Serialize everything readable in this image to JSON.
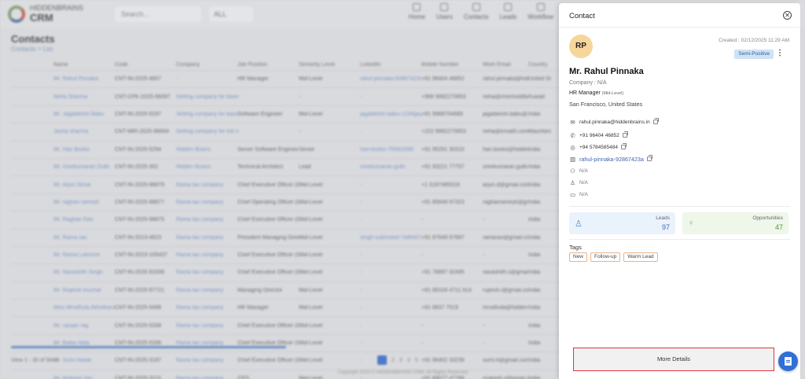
{
  "background": {
    "brand_small": "HIDDENBRAINS",
    "brand": "CRM",
    "search_placeholder": "Search...",
    "select_value": "ALL",
    "nav": [
      "Home",
      "Users",
      "Contacts",
      "Leads",
      "Workflow"
    ],
    "page_title": "Contacts",
    "breadcrumb": "Contacts  >  List",
    "columns": [
      "Name",
      "Code",
      "Company",
      "Job Position",
      "Seniority Level",
      "LinkedIn",
      "Mobile Number",
      "Work Email",
      "Country"
    ],
    "rows": [
      [
        "Mr. Rahul Pinnaka",
        "CNT-IN-2025-4857",
        "-",
        "HR Manager",
        "Mid-Level",
        "rahul-pinnaka-92867423a",
        "+91 96404 46852",
        "rahul.pinnaka@hid..",
        "United St"
      ],
      [
        "Neha Sharma",
        "CNT-CPK-2025-56097",
        "Setting company for basic job whole flow",
        "-",
        "-",
        "-",
        "+966 9992270653",
        "neha@chermoldfa..",
        "Kuwait"
      ],
      [
        "Mr. Jagadeesh Babu",
        "CNT-IN-2025-5297",
        "Setting company for basic job whole flow",
        "Software Engineer",
        "Mid-Level",
        "jagadeesh-babu-1234gxyfbb",
        "+91 9989754689",
        "jagadeesh.babu@..",
        "India"
      ],
      [
        "Jasha sharma",
        "CNT-MRI-2025-96684",
        "Setting company for full data",
        "-",
        "-",
        "-",
        "+222 9992270653",
        "neha@email0.com..",
        "Mauritani"
      ],
      [
        "Mr. Hari Bosko",
        "CNT-IN-2025-5294",
        "Hidden Brains",
        "Senior Software Engineer",
        "Senior",
        "hari-bosko-70582f390",
        "+91 95291 30310",
        "hari.bosko@hiddenb..",
        "India"
      ],
      [
        "Mr. Sreekumaran Dulki",
        "CNT-IN-2025-302",
        "Hidden Brains",
        "Technical Architect",
        "Lead",
        "sreekumaran-gulki",
        "+91 93221 77757",
        "sreekumaran.gulki..",
        "India"
      ],
      [
        "Mr. Arjun Desai",
        "CNT-IN-2025-98879",
        "Rama tax company",
        "Chief Executive Officer (CEO)",
        "Mid-Level",
        "-",
        "+1 3187485318",
        "arjun.d@gmail.com",
        "India"
      ],
      [
        "Mr. raghav rameyk",
        "CNT-IN-2025-98877",
        "Rama tax company",
        "Chief Operating Officer (COO)",
        "Mid-Level",
        "-",
        "+91 85649 97323",
        "raghavrameyk@gm..",
        "India"
      ],
      [
        "Mr. Raghav Rao",
        "CNT-IN-2025-98875",
        "Rama tax company",
        "Chief Executive Officer (CEO)",
        "Mid-Level",
        "-",
        "-",
        "-",
        "India"
      ],
      [
        "Mr. Rama rao",
        "CNT-IN-2013-4823",
        "Rama tax company",
        "President Managing Director",
        "Mid-Level",
        "singh-sukhmeet-7a8f4d7a",
        "+91 87649 97687",
        "ramarao@gmail.com",
        "India"
      ],
      [
        "Mr. Rama Lukonne",
        "CNT-IN-2023-105437",
        "Rama tax company",
        "Chief Executive Officer (CEO)",
        "Mid-Level",
        "-",
        "-",
        "-",
        "India"
      ],
      [
        "Mr. Navashith Singh",
        "CNT-IN-2025-91938",
        "Rama tax company",
        "Chief Executive Officer (CEO)",
        "Mid-Level",
        "-",
        "+91 78897 32495",
        "navashith.s@gmail..",
        "India"
      ],
      [
        "Mr. Rupesh Inuchar",
        "CNT-IN-2025-97721",
        "Rama tax company",
        "Managing Director",
        "Mid-Level",
        "-",
        "+91 88104 4711 614",
        "rupesh.i@gmail.com",
        "India"
      ],
      [
        "Miss Mrudhula Akhotkana",
        "CNT-IN-2025-5498",
        "Rama tax company",
        "HR Manager",
        "Mid-Level",
        "-",
        "+91 8837 7519",
        "mrudhula@hidden..",
        "India"
      ],
      [
        "Mr. sanjan rag",
        "CNT-IN-2025-5338",
        "Rama tax company",
        "Chief Executive Officer (CEO)",
        "Mid-Level",
        "-",
        "-",
        "-",
        "India"
      ],
      [
        "Mr. Batas daily",
        "CNT-IN-2025-5336",
        "Rama tax company",
        "Chief Executive Officer (CEO)",
        "Mid-Level",
        "-",
        "-",
        "-",
        "India"
      ],
      [
        "Mr. Sumi Hadar",
        "CNT-IN-2025-3187",
        "Rama tax company",
        "Chief Executive Officer (CEO)",
        "Mid-Level",
        "-",
        "+91 96402 33239",
        "sumi.h@gmail.com",
        "India"
      ],
      [
        "Mr. Mukesh Yan",
        "CNT-IN-2025-3113",
        "Rama tax company",
        "CFO",
        "Mid-Level",
        "-",
        "+91 89077 47789",
        "mukesh.y@gmail.com",
        "India"
      ]
    ],
    "view_text": "View  1 - 30  of  5843",
    "pages": [
      "1",
      "2",
      "3",
      "4",
      "5"
    ],
    "copyright": "Copyright 2025 © HIDDENBRAINS CRM. All Rights Reserved."
  },
  "panel": {
    "title": "Contact",
    "avatar_initials": "RP",
    "created": "Created : 02/12/2025 11:29 AM",
    "sentiment": "Semi-Positive",
    "name": "Mr. Rahul Pinnaka",
    "company_label": "Company :",
    "company_value": "N/A",
    "position": "HR Manager",
    "seniority": "(Mid-Level)",
    "location": "San Francisco, United States",
    "email": "rahul.pinnaka@hiddenbrains.in",
    "phone": "+91 96404 46852",
    "whatsapp": "+94 5784585484",
    "linkedin": "rahul-pinnaka-92867423a",
    "na_1": "N/A",
    "na_2": "N/A",
    "na_3": "N/A",
    "leads_label": "Leads",
    "leads_value": "97",
    "opps_label": "Opportunities",
    "opps_value": "47",
    "tags_label": "Tags",
    "tags": [
      "New",
      "Follow-up",
      "Warm Lead"
    ],
    "more_details": "More Details"
  },
  "colors": {
    "accent": "#2f6fd6",
    "avatar_bg": "#f6d69a",
    "sentiment_bg": "#cfe3f7",
    "highlight_border": "#e0333a"
  }
}
